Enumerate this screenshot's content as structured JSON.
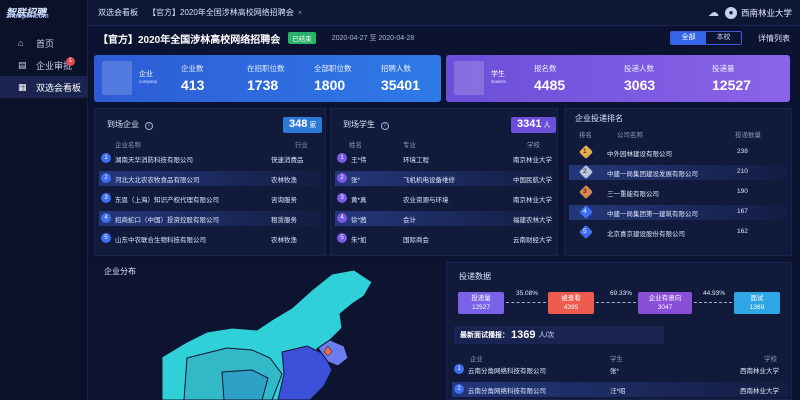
{
  "logo": {
    "text": "智联招聘",
    "sub": "zhaopin.com"
  },
  "sidebar": {
    "items": [
      {
        "label": "首页",
        "icon": "home-icon"
      },
      {
        "label": "企业审批",
        "icon": "approval-icon",
        "badge": "1"
      },
      {
        "label": "双选会看板",
        "icon": "dashboard-icon"
      }
    ]
  },
  "topbar": {
    "tabs": [
      {
        "label": "双选会看板"
      },
      {
        "label": "【官方】2020年全国涉林高校网络招聘会"
      }
    ],
    "user": "西南林业大学"
  },
  "header": {
    "title": "【官方】2020年全国涉林高校网络招聘会",
    "status": "已结束",
    "date_range": "2020-04-27 至 2020-04-28",
    "seg_all": "全部",
    "seg_school": "本校",
    "detail_link": "详情列表"
  },
  "company_card": {
    "icon_label": "企业",
    "icon_sub": "company",
    "stats": [
      {
        "label": "企业数",
        "value": "413"
      },
      {
        "label": "在招职位数",
        "value": "1738"
      },
      {
        "label": "全部职位数",
        "value": "1800"
      },
      {
        "label": "招聘人数",
        "value": "35401"
      }
    ]
  },
  "student_card": {
    "icon_label": "学生",
    "icon_sub": "student",
    "stats": [
      {
        "label": "报名数",
        "value": "4485"
      },
      {
        "label": "投递人数",
        "value": "3063"
      },
      {
        "label": "投递量",
        "value": "12527"
      }
    ]
  },
  "arrived_companies": {
    "title": "到场企业",
    "count": "348",
    "unit": "家",
    "col_name": "企业名称",
    "col_industry": "行业",
    "rows": [
      {
        "no": "1",
        "name": "湖南天华消防科技有限公司",
        "industry": "快速消费品"
      },
      {
        "no": "2",
        "name": "河北大北农农牧食品有限公司",
        "industry": "农林牧渔"
      },
      {
        "no": "3",
        "name": "东恩（上海）知识产权代理有限公司",
        "industry": "咨询服务"
      },
      {
        "no": "4",
        "name": "招商蛇口（中国）投资控股有限公司",
        "industry": "租赁服务"
      },
      {
        "no": "5",
        "name": "山东中农联合生物科技有限公司",
        "industry": "农林牧渔"
      }
    ]
  },
  "arrived_students": {
    "title": "到场学生",
    "count": "3341",
    "unit": "人",
    "col_name": "姓名",
    "col_major": "专业",
    "col_school": "学校",
    "rows": [
      {
        "no": "1",
        "name": "王*伟",
        "major": "环境工程",
        "school": "南京林业大学"
      },
      {
        "no": "2",
        "name": "张*",
        "major": "飞机机电设备维修",
        "school": "中国民航大学"
      },
      {
        "no": "3",
        "name": "黄*真",
        "major": "农业资源与环境",
        "school": "南京林业大学"
      },
      {
        "no": "4",
        "name": "徐*茜",
        "major": "会计",
        "school": "福建农林大学"
      },
      {
        "no": "5",
        "name": "朱*如",
        "major": "国际商会",
        "school": "云南财经大学"
      }
    ]
  },
  "delivery_ranking": {
    "title": "企业投递排名",
    "col_rank": "排名",
    "col_name": "公司名称",
    "col_count": "投递数量",
    "rows": [
      {
        "rank": "1",
        "name": "中外园林建设有限公司",
        "count": "238",
        "medal": "#e2b04a"
      },
      {
        "rank": "2",
        "name": "中建一局集团建设发展有限公司",
        "count": "210",
        "medal": "#b9c3d8"
      },
      {
        "rank": "3",
        "name": "三一重能有限公司",
        "count": "190",
        "medal": "#d9874b"
      },
      {
        "rank": "4",
        "name": "中建一局集团第一建筑有限公司",
        "count": "167",
        "medal": "#3e6ef0"
      },
      {
        "rank": "5",
        "name": "北京喜京建设股份有限公司",
        "count": "162",
        "medal": "#3e6ef0"
      }
    ]
  },
  "map": {
    "title": "企业分布"
  },
  "delivery_data": {
    "title": "投递数据",
    "funnel": [
      {
        "label": "投递量",
        "value": "12527",
        "color": "#7a62e8"
      },
      {
        "label": "被查看",
        "value": "4395",
        "color": "#ef5a4e"
      },
      {
        "label": "企业有意向",
        "value": "3047",
        "color": "#8a4fd8"
      },
      {
        "label": "面试",
        "value": "1369",
        "color": "#2fa7e6"
      }
    ],
    "pcts": [
      "35.08%",
      "69.33%",
      "44.93%"
    ],
    "latest_label": "最新面试播报：",
    "latest_value": "1369",
    "latest_unit": "人/次",
    "col_company": "企业",
    "col_student": "学生",
    "col_school": "学校",
    "rows": [
      {
        "no": "1",
        "company": "云南分角网络科技有限公司",
        "student": "张*",
        "school": "西南林业大学"
      },
      {
        "no": "2",
        "company": "云南分角网络科技有限公司",
        "student": "汪*昭",
        "school": "西南林业大学"
      }
    ]
  }
}
